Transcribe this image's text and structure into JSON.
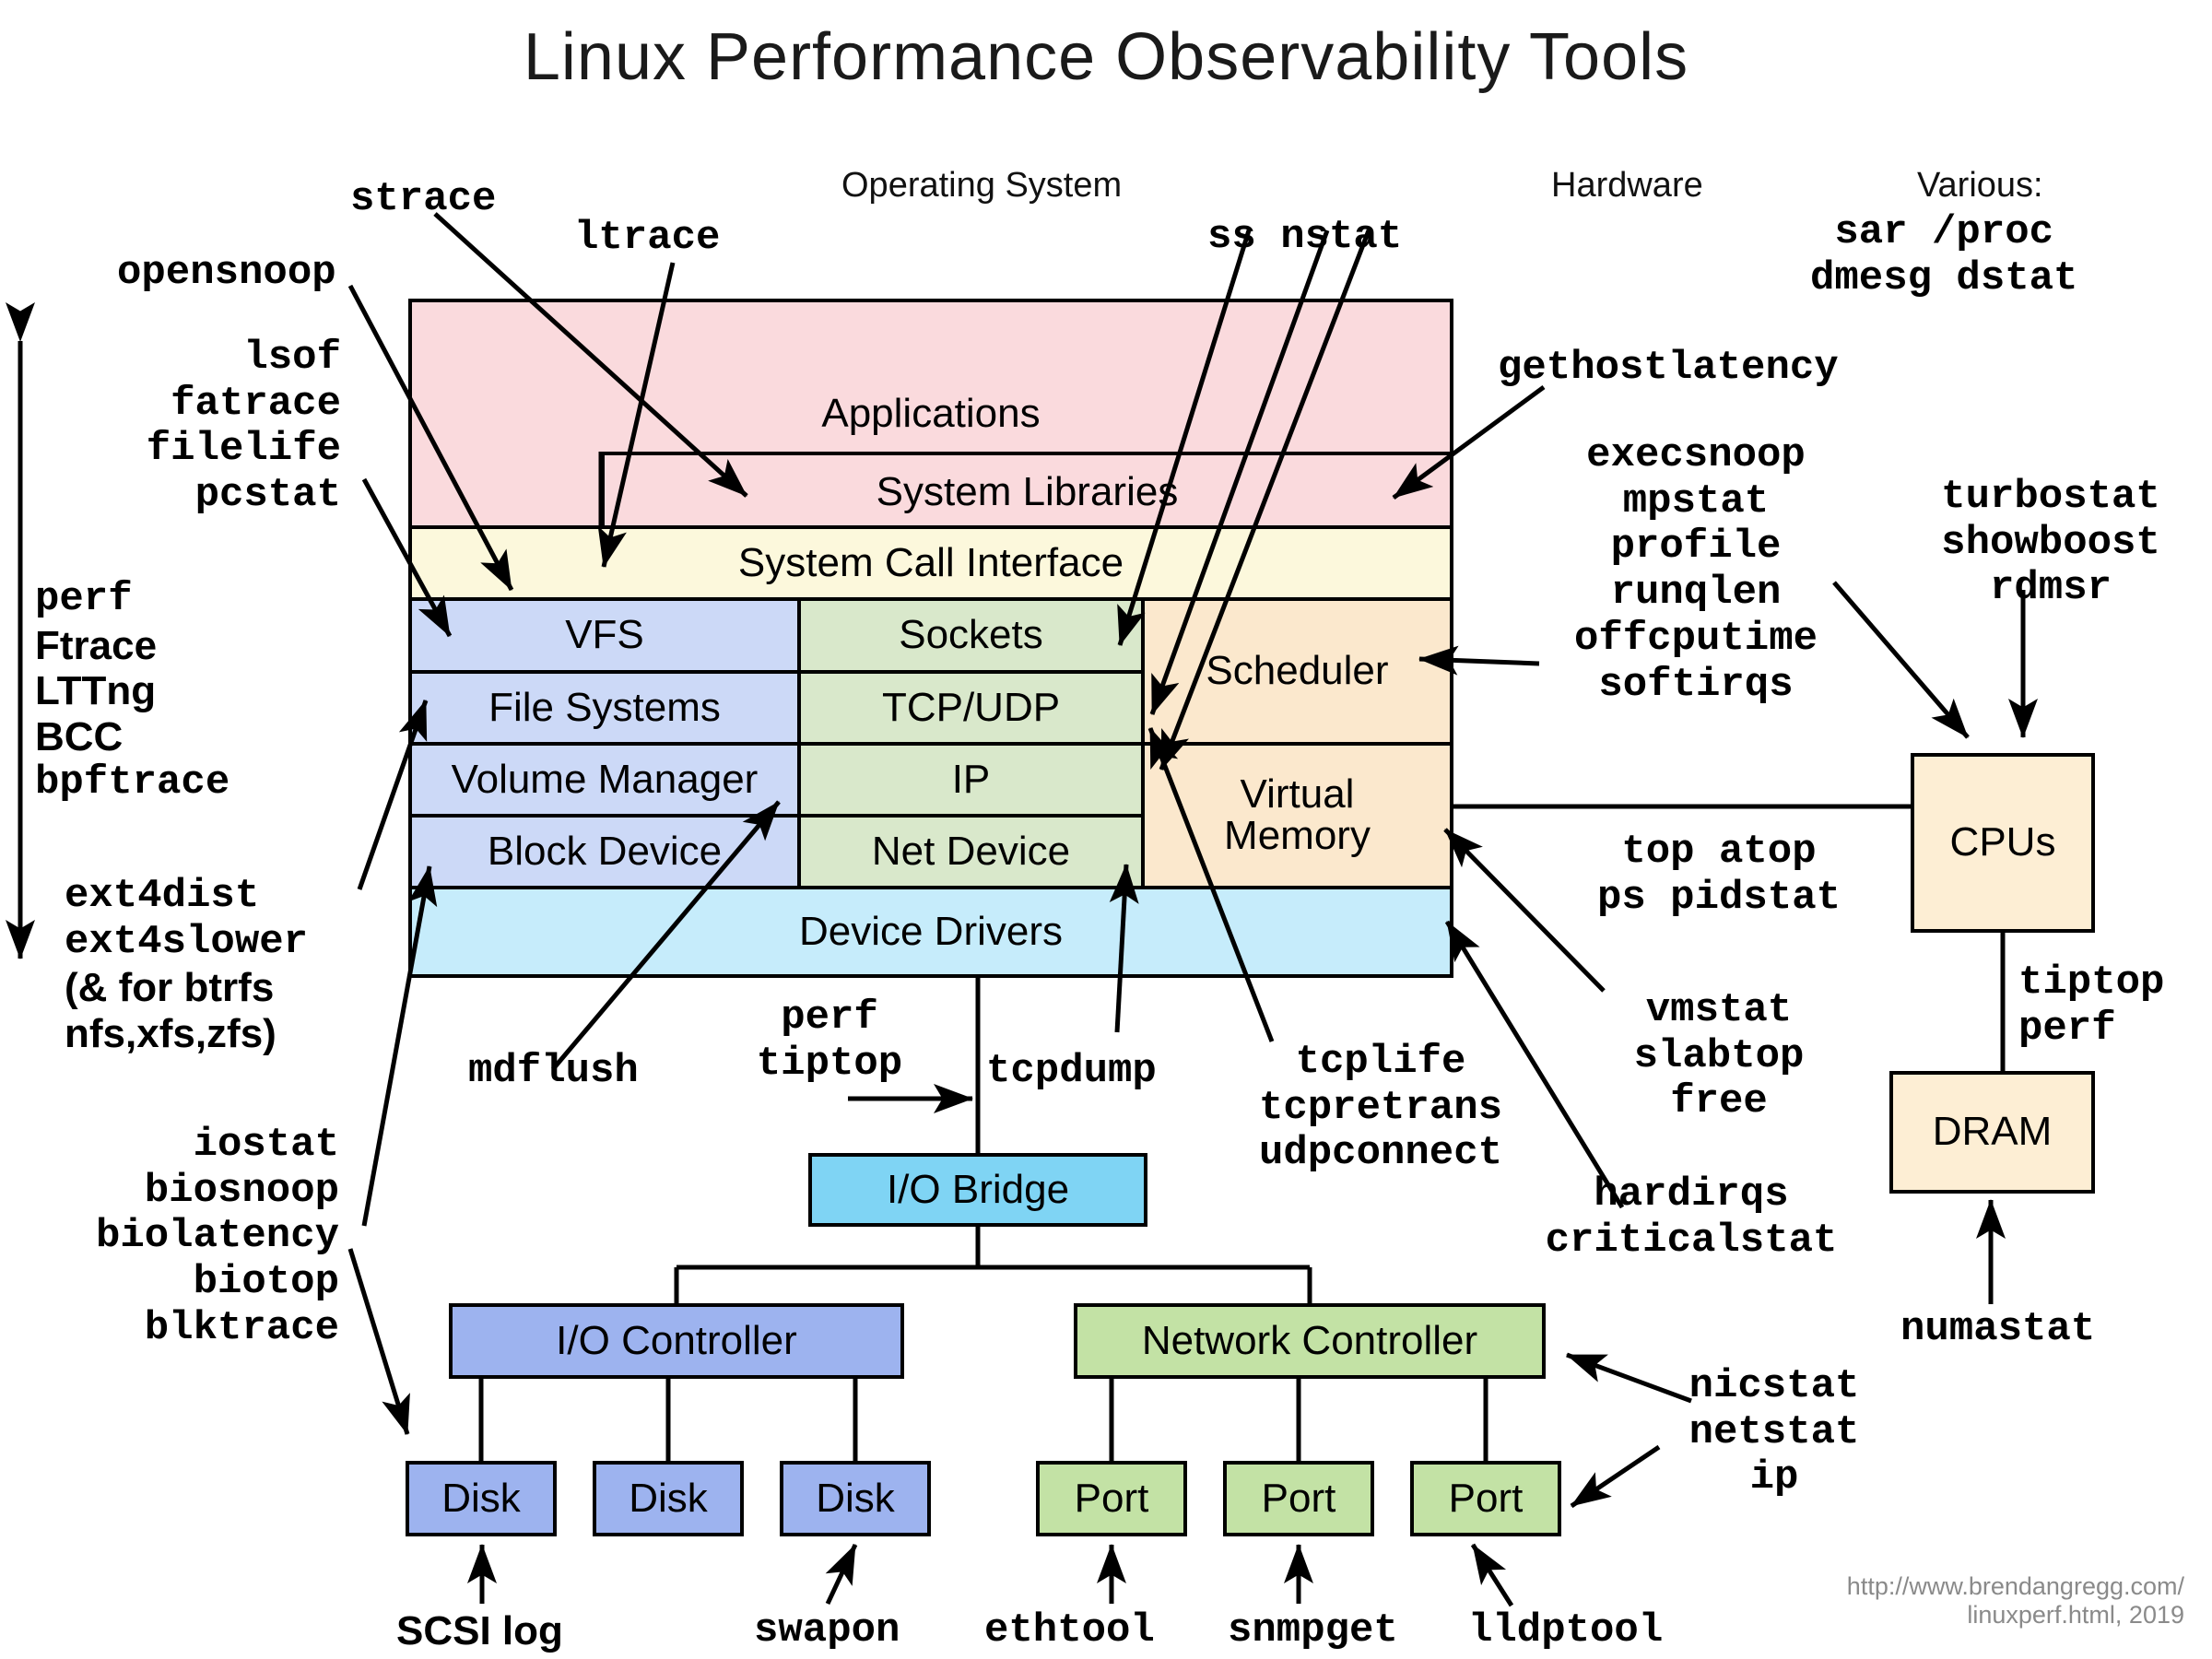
{
  "title": "Linux Performance Observability Tools",
  "sections": {
    "operating_system": "Operating System",
    "hardware": "Hardware",
    "various_label": "Various:"
  },
  "stack": {
    "applications": "Applications",
    "system_libraries": "System Libraries",
    "system_call_interface": "System Call Interface",
    "vfs": "VFS",
    "file_systems": "File Systems",
    "volume_manager": "Volume Manager",
    "block_device": "Block Device",
    "sockets": "Sockets",
    "tcp_udp": "TCP/UDP",
    "ip": "IP",
    "net_device": "Net Device",
    "scheduler": "Scheduler",
    "virtual_memory": "Virtual\nMemory",
    "device_drivers": "Device Drivers"
  },
  "hardware_boxes": {
    "cpus": "CPUs",
    "dram": "DRAM",
    "io_bridge": "I/O Bridge",
    "io_controller": "I/O Controller",
    "network_controller": "Network Controller",
    "disk1": "Disk",
    "disk2": "Disk",
    "disk3": "Disk",
    "port1": "Port",
    "port2": "Port",
    "port3": "Port"
  },
  "tools": {
    "strace": "strace",
    "ltrace": "ltrace",
    "opensnoop": "opensnoop",
    "ss_nstat": "ss nstat",
    "various_cmds": "sar /proc\ndmesg dstat",
    "lsof_group": "lsof\nfatrace\nfilelife\npcstat",
    "tracers": "perf\nFtrace\nLTTng\nBCC\nbpftrace",
    "tracers_lines": [
      "perf",
      "Ftrace",
      "LTTng",
      "BCC",
      "bpftrace"
    ],
    "ext4_group": "ext4dist\next4slower\n(& for btrfs\nnfs,xfs,zfs)",
    "ext4_lines": [
      "ext4dist",
      "ext4slower",
      "(& for btrfs",
      "nfs,xfs,zfs)"
    ],
    "iostat_group": "iostat\nbiosnoop\nbiolatency\nbiotop\nblktrace",
    "gethostlatency": "gethostlatency",
    "cpu_group": "execsnoop\nmpstat\nprofile\nrunqlen\noffcputime\nsoftirqs",
    "turbostat_group": "turbostat\nshowboost\nrdmsr",
    "top_group": "top atop\nps pidstat",
    "vmstat_group": "vmstat\nslabtop\nfree",
    "hardirqs_group": "hardirqs\ncriticalstat",
    "tiptop_perf": "tiptop\nperf",
    "numastat": "numastat",
    "mdflush": "mdflush",
    "perf_tiptop": "perf\ntiptop",
    "tcpdump": "tcpdump",
    "tcp_group": "tcplife\ntcpretrans\nudpconnect",
    "nicstat_group": "nicstat\nnetstat\nip",
    "scsi_log": "SCSI log",
    "swapon": "swapon",
    "ethtool": "ethtool",
    "snmpget": "snmpget",
    "lldptool": "lldptool"
  },
  "credit": "http://www.brendangregg.com/\nlinuxperf.html, 2019",
  "colors": {
    "applications": "#fadadd",
    "syscall": "#fcf8dc",
    "fs_column": "#ccd9f7",
    "net_column": "#d9e8cb",
    "sched_column": "#fbe8cd",
    "device_drivers": "#c6ecfb",
    "io_bridge": "#7fd4f4",
    "io_controller": "#9db3ef",
    "network_controller": "#c3e2a5",
    "hardware": "#fdeed4",
    "credit_text": "#8a8a8a"
  }
}
